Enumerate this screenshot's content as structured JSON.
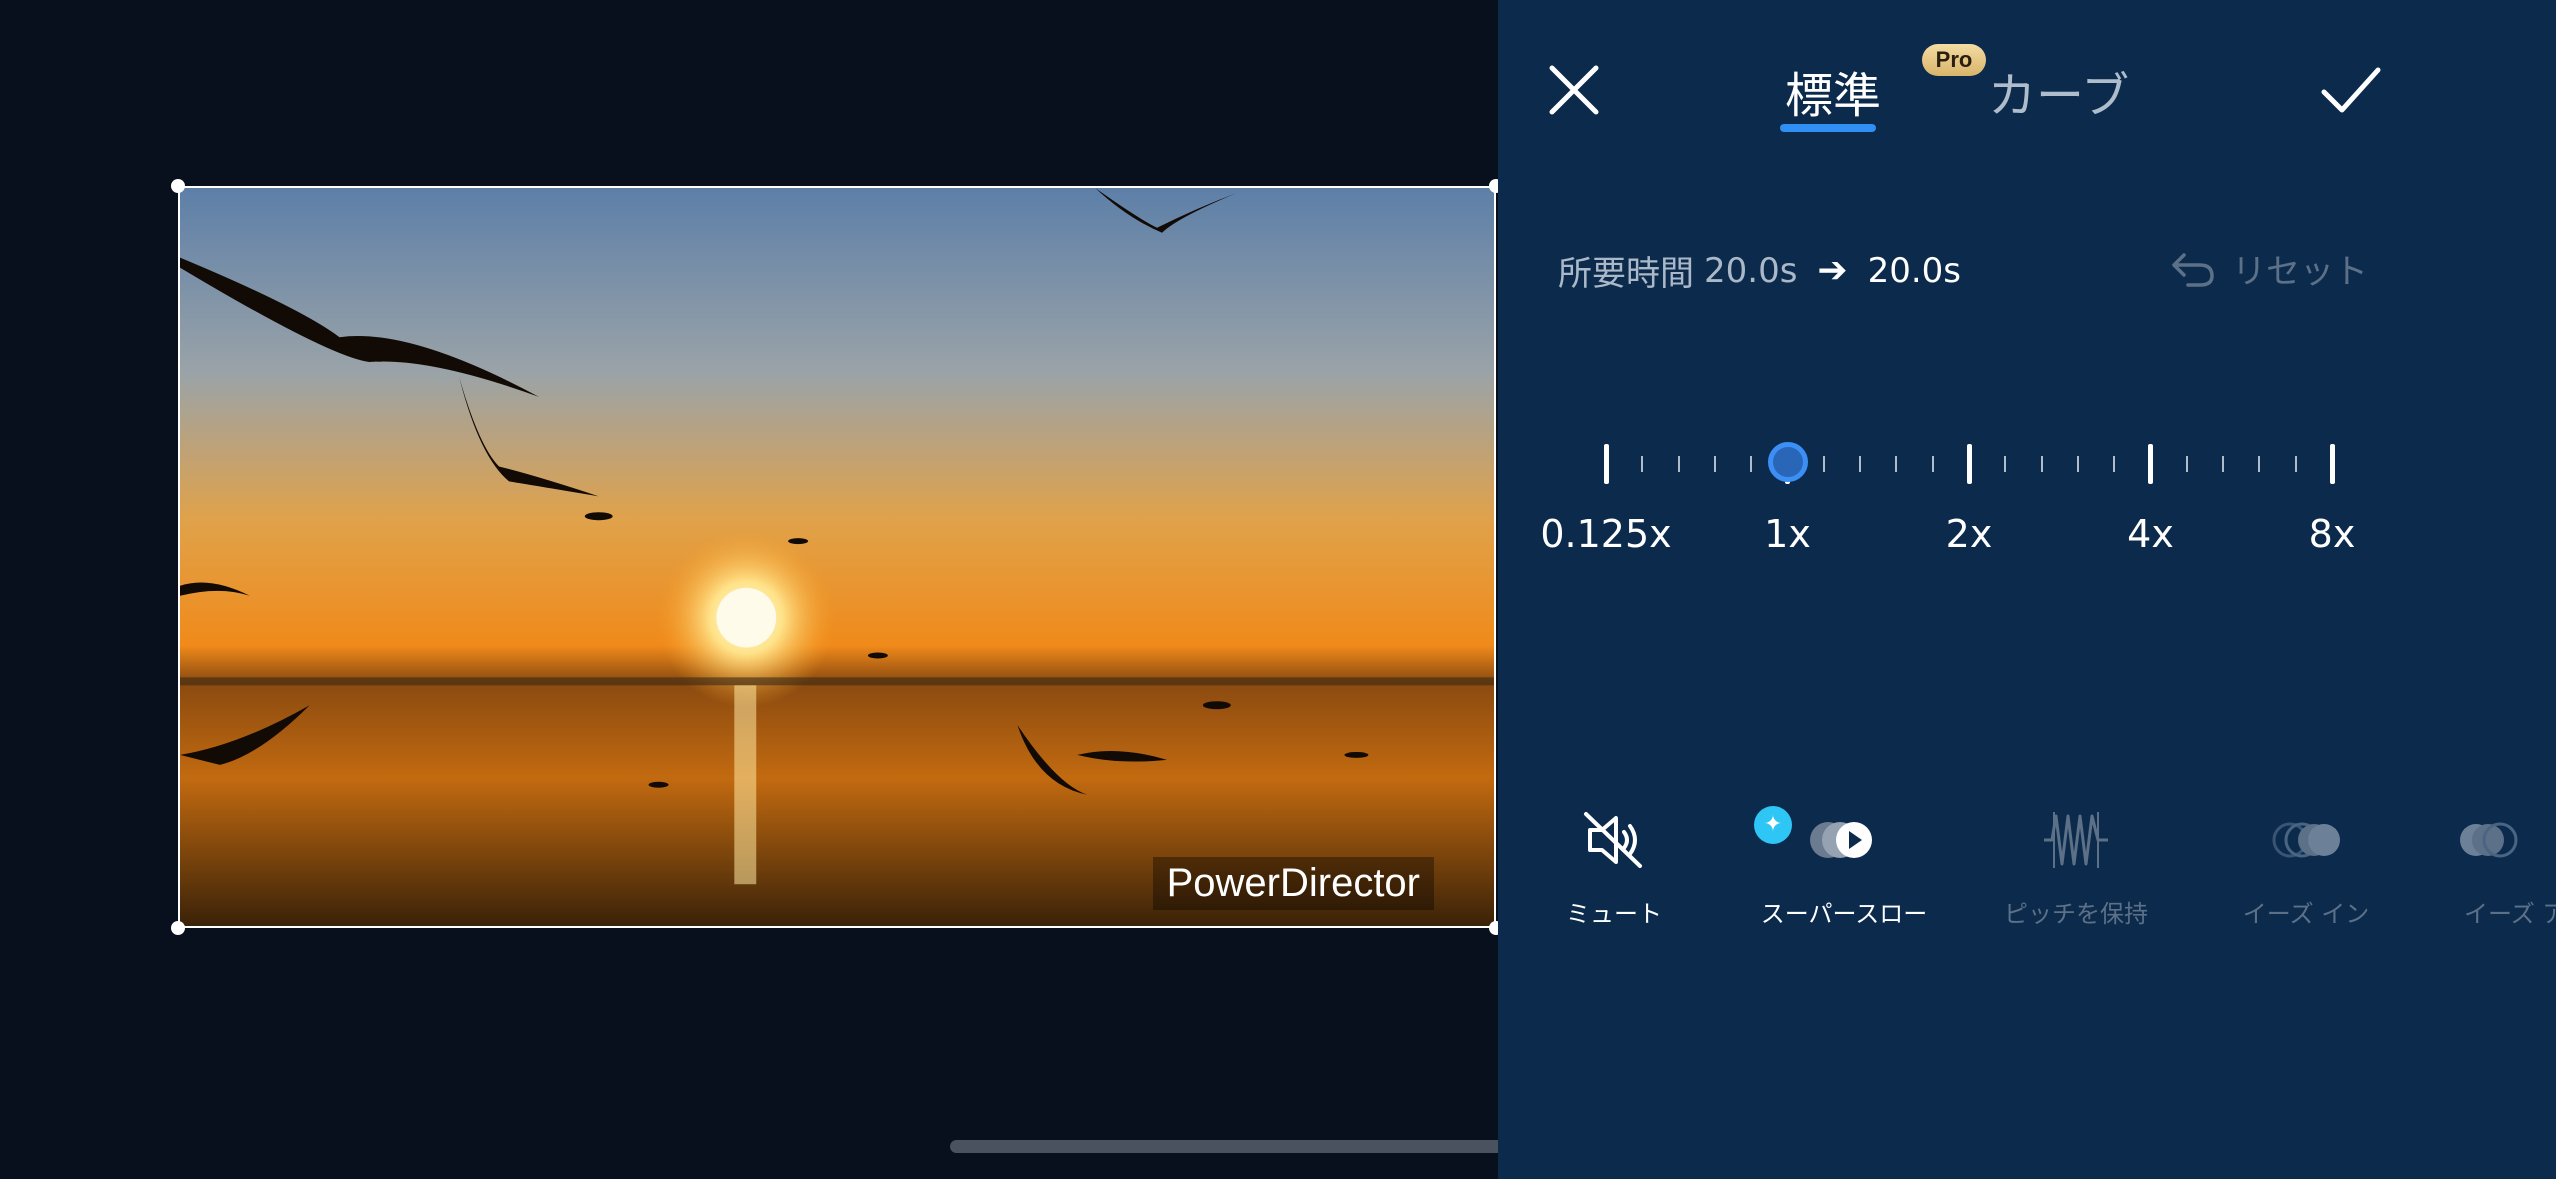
{
  "preview": {
    "watermark": "PowerDirector"
  },
  "header": {
    "tabs": [
      {
        "label": "標準",
        "active": true
      },
      {
        "label": "カーブ",
        "active": false
      }
    ],
    "pro_badge": "Pro"
  },
  "duration": {
    "label": "所要時間",
    "original": "20.0s",
    "new": "20.0s"
  },
  "reset_label": "リセット",
  "speed_slider": {
    "labels": [
      "0.125x",
      "1x",
      "2x",
      "4x",
      "8x"
    ],
    "current_value": "1x"
  },
  "tools": [
    {
      "label": "ミュート",
      "icon": "mute-icon",
      "enabled": true
    },
    {
      "label": "スーパースロー",
      "icon": "super-slow-icon",
      "enabled": true
    },
    {
      "label": "ピッチを保持",
      "icon": "waveform-icon",
      "enabled": false
    },
    {
      "label": "イーズ イン",
      "icon": "ease-in-icon",
      "enabled": false
    },
    {
      "label": "イーズ ア",
      "icon": "ease-out-icon",
      "enabled": false
    }
  ],
  "colors": {
    "accent": "#2f8ff2",
    "panel_bg": "#0c2b4c",
    "preview_bg": "#09101d"
  }
}
